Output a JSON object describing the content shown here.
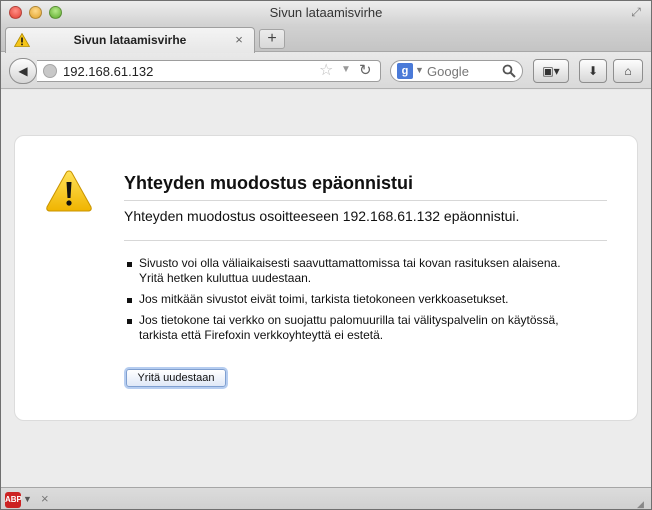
{
  "window": {
    "title": "Sivun lataamisvirhe"
  },
  "tabs": [
    {
      "label": "Sivun lataamisvirhe",
      "icon": "warning-icon",
      "active": true
    }
  ],
  "toolbar": {
    "url": "192.168.61.132",
    "search_placeholder": "Google",
    "search_engine_letter": "g"
  },
  "error": {
    "title": "Yhteyden muodostus epäonnistui",
    "description": "Yhteyden muodostus osoitteeseen 192.168.61.132 epäonnistui.",
    "bullets": [
      "Sivusto voi olla väliaikaisesti saavuttamattomissa tai kovan rasituksen alaisena. Yritä hetken kuluttua uudestaan.",
      "Jos mitkään sivustot eivät toimi, tarkista tietokoneen verkkoasetukset.",
      "Jos tietokone tai verkko on suojattu palomuurilla tai välityspalvelin on käytössä, tarkista että Firefoxin verkkoyhteyttä ei estetä."
    ],
    "retry_label": "Yritä uudestaan"
  },
  "statusbar": {
    "addon_label": "ABP"
  },
  "colors": {
    "warning": "#f5c518",
    "focus": "#b6cdf0"
  }
}
